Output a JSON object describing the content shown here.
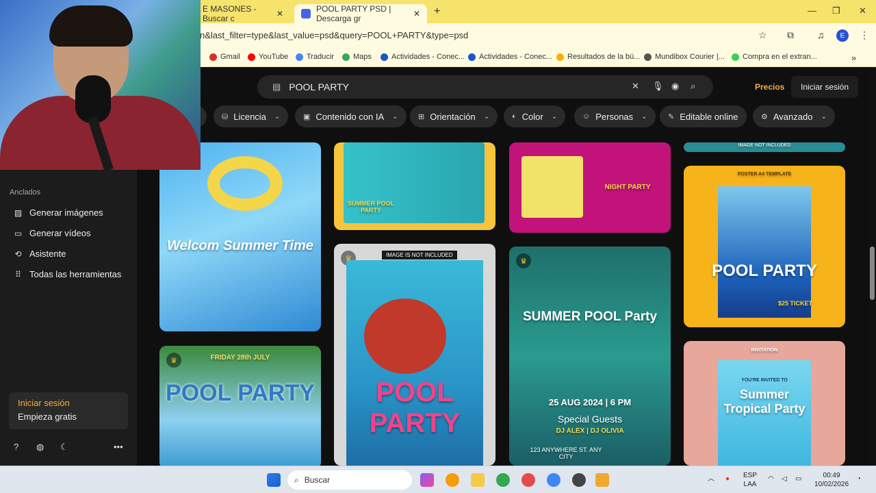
{
  "browser": {
    "tabs": [
      {
        "title": "E MASONES - Buscar c",
        "active": false
      },
      {
        "title": "POOL PARTY PSD | Descarga gr",
        "active": true
      }
    ],
    "url": "n&last_filter=type&last_value=psd&query=POOL+PARTY&type=psd",
    "profile_initial": "E",
    "bookmarks": [
      {
        "label": "Gmail",
        "color": "#d93025"
      },
      {
        "label": "YouTube",
        "color": "#ff0000"
      },
      {
        "label": "Traducir",
        "color": "#4285f4"
      },
      {
        "label": "Maps",
        "color": "#34a853"
      },
      {
        "label": "Actividades - Conec...",
        "color": "#1a56c9"
      },
      {
        "label": "Actividades - Conec...",
        "color": "#1a56c9"
      },
      {
        "label": "Resultados de la bú...",
        "color": "#f4b400"
      },
      {
        "label": "Mundibox Courier |...",
        "color": "#555555"
      },
      {
        "label": "Compra en el extran...",
        "color": "#3ccf4e"
      }
    ]
  },
  "sidebar": {
    "heading": "Anclados",
    "items": [
      {
        "label": "Generar imágenes",
        "icon": "image-icon"
      },
      {
        "label": "Generar vídeos",
        "icon": "video-icon"
      },
      {
        "label": "Asistente",
        "icon": "chat-icon"
      },
      {
        "label": "Todas las herramientas",
        "icon": "grid-icon"
      }
    ],
    "login": {
      "title": "Iniciar sesión",
      "subtitle": "Empieza gratis"
    }
  },
  "header": {
    "search_value": "POOL PARTY",
    "pricing": "Precios",
    "login": "Iniciar sesión"
  },
  "filters": [
    {
      "label": "Licencia",
      "icon": "license-icon"
    },
    {
      "label": "Contenido con IA",
      "icon": "ai-icon"
    },
    {
      "label": "Orientación",
      "icon": "orientation-icon"
    },
    {
      "label": "Color",
      "icon": "palette-icon"
    },
    {
      "label": "Personas",
      "icon": "people-icon"
    },
    {
      "label": "Editable online",
      "icon": "pencil-icon"
    },
    {
      "label": "Avanzado",
      "icon": "settings-icon"
    }
  ],
  "cards": {
    "c1": {
      "title": "Welcom Summer Time"
    },
    "c2": {
      "title": "SUMMER POOL PARTY"
    },
    "c3": {
      "title": "NIGHT PARTY"
    },
    "c4": {
      "subtitle": "POSTER A4 TEMPLATE",
      "title": "POOL PARTY",
      "price": "$25 TICKET"
    },
    "c5": {
      "title": "POOL PARTY",
      "date": "FRIDAY 28th JULY"
    },
    "c6": {
      "badge": "IMAGE IS NOT INCLUDED",
      "title": "POOL PARTY"
    },
    "c7": {
      "title": "SUMMER POOL Party",
      "date": "25 AUG 2024 | 6 PM",
      "guests": "Special Guests",
      "djs": "DJ ALEX | DJ OLIVIA",
      "address": "123 ANYWHERE ST. ANY CITY"
    },
    "c8": {
      "subtitle": "INVITATION",
      "invite": "YOU'RE INVITED TO",
      "title": "Summer Tropical Party"
    },
    "c0": {
      "badge": "IMAGE NOT INCLUDED"
    }
  },
  "taskbar": {
    "search": "Buscar",
    "lang": "ESP",
    "lang2": "LAA",
    "time": "00:49",
    "date": "10/02/2026"
  }
}
